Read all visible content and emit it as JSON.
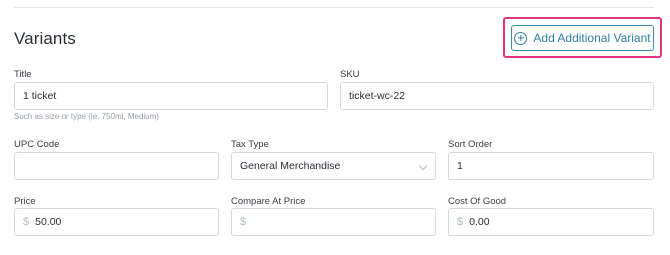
{
  "section": {
    "title": "Variants",
    "add_button_label": "Add Additional Variant"
  },
  "fields": {
    "title": {
      "label": "Title",
      "value": "1 ticket",
      "helper": "Such as size or type (ie. 750ml, Medium)"
    },
    "sku": {
      "label": "SKU",
      "value": "ticket-wc-22"
    },
    "upc": {
      "label": "UPC Code",
      "value": ""
    },
    "tax_type": {
      "label": "Tax Type",
      "value": "General Merchandise"
    },
    "sort_order": {
      "label": "Sort Order",
      "value": "1"
    },
    "price": {
      "label": "Price",
      "currency": "$",
      "value": "50.00"
    },
    "compare_price": {
      "label": "Compare At Price",
      "currency": "$",
      "value": ""
    },
    "cost": {
      "label": "Cost Of Good",
      "currency": "$",
      "value": "0.00"
    }
  },
  "colors": {
    "accent": "#2f7ea3",
    "highlight": "#e0357f"
  },
  "icons": {
    "add": "plus-circle-icon",
    "select": "chevron-down-icon"
  }
}
